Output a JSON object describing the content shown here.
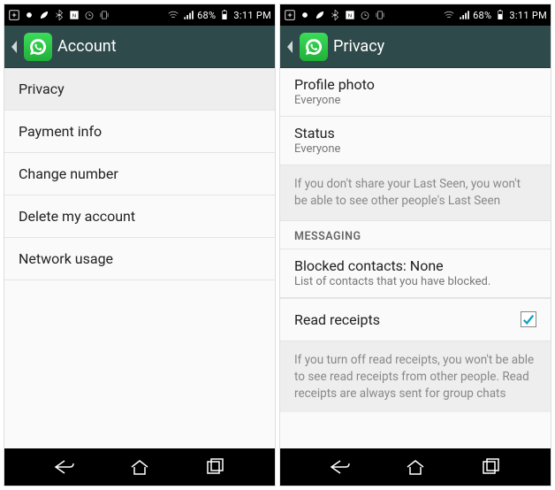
{
  "status": {
    "battery": "68%",
    "time": "3:11 PM"
  },
  "left": {
    "title": "Account",
    "items": [
      {
        "label": "Privacy",
        "highlight": true
      },
      {
        "label": "Payment info"
      },
      {
        "label": "Change number"
      },
      {
        "label": "Delete my account"
      },
      {
        "label": "Network usage"
      }
    ]
  },
  "right": {
    "title": "Privacy",
    "profile_photo": {
      "label": "Profile photo",
      "value": "Everyone"
    },
    "status_item": {
      "label": "Status",
      "value": "Everyone"
    },
    "last_seen_info": "If you don't share your Last Seen, you won't be able to see other people's Last Seen",
    "section_messaging": "MESSAGING",
    "blocked": {
      "label": "Blocked contacts: None",
      "sub": "List of contacts that you have blocked."
    },
    "read_receipts": {
      "label": "Read receipts",
      "checked": true
    },
    "read_receipts_info": "If you turn off read receipts, you won't be able to see read receipts from other people. Read receipts are always sent for group chats"
  }
}
